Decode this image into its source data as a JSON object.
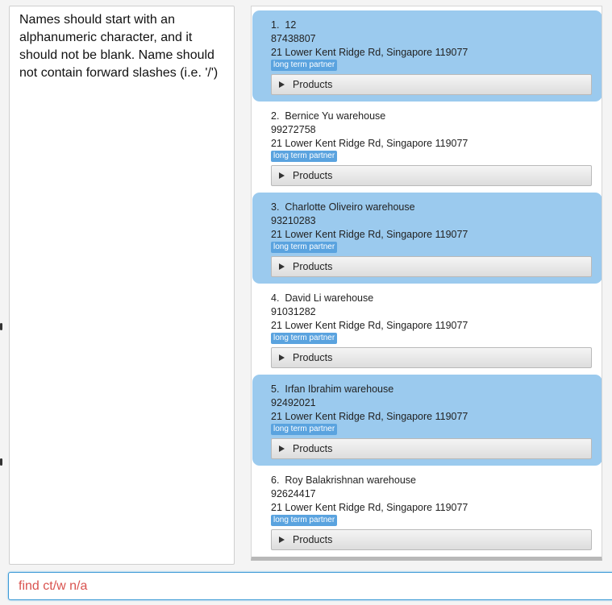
{
  "result_display": {
    "text": "Names should start with an alphanumeric character, and it should not be blank. Name should not contain forward slashes (i.e. '/')"
  },
  "contacts": [
    {
      "index": "1.",
      "name": "12",
      "phone": "87438807",
      "address": "21 Lower Kent Ridge Rd, Singapore 119077",
      "tag": "long term partner",
      "products_label": "Products",
      "selected": true
    },
    {
      "index": "2.",
      "name": "Bernice Yu warehouse",
      "phone": "99272758",
      "address": "21 Lower Kent Ridge Rd, Singapore 119077",
      "tag": "long term partner",
      "products_label": "Products",
      "selected": false
    },
    {
      "index": "3.",
      "name": "Charlotte Oliveiro warehouse",
      "phone": "93210283",
      "address": "21 Lower Kent Ridge Rd, Singapore 119077",
      "tag": "long term partner",
      "products_label": "Products",
      "selected": true
    },
    {
      "index": "4.",
      "name": "David Li warehouse",
      "phone": "91031282",
      "address": "21 Lower Kent Ridge Rd, Singapore 119077",
      "tag": "long term partner",
      "products_label": "Products",
      "selected": false
    },
    {
      "index": "5.",
      "name": "Irfan Ibrahim warehouse",
      "phone": "92492021",
      "address": "21 Lower Kent Ridge Rd, Singapore 119077",
      "tag": "long term partner",
      "products_label": "Products",
      "selected": true
    },
    {
      "index": "6.",
      "name": "Roy Balakrishnan warehouse",
      "phone": "92624417",
      "address": "21 Lower Kent Ridge Rd, Singapore 119077",
      "tag": "long term partner",
      "products_label": "Products",
      "selected": false
    }
  ],
  "command_box": {
    "value": "find ct/w n/a"
  },
  "colors": {
    "selected_card": "#9bcaee",
    "tag": "#5aa3df",
    "error_text": "#d9534f",
    "input_border": "#3c9ad6"
  }
}
